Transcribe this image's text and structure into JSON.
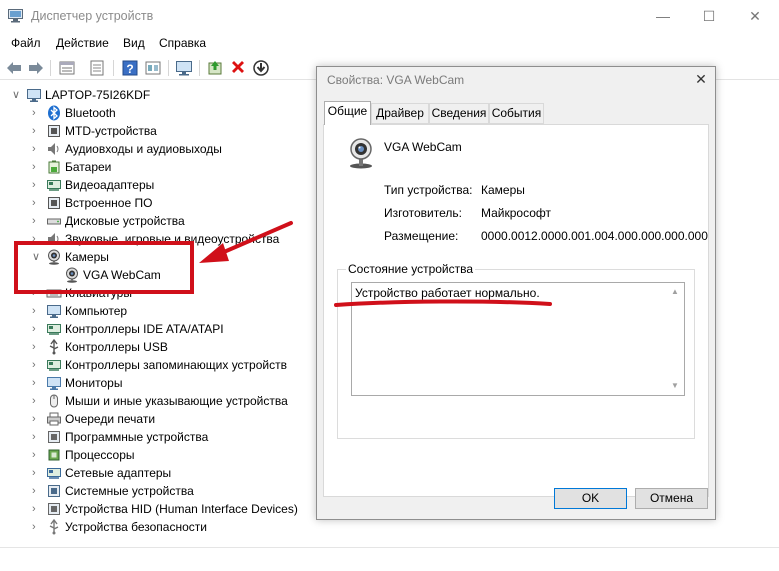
{
  "window": {
    "title": "Диспетчер устройств",
    "minimize": "—",
    "maximize": "☐",
    "close": "✕"
  },
  "menu": [
    "Файл",
    "Действие",
    "Вид",
    "Справка"
  ],
  "toolbar": [
    "back-icon",
    "forward-icon",
    "properties-view-icon",
    "list-icon",
    "help-icon",
    "view-icon",
    "monitor-icon",
    "update-driver-icon",
    "uninstall-icon",
    "download-icon"
  ],
  "tree": {
    "root": "LAPTOP-75I26KDF",
    "items": [
      {
        "label": "Bluetooth",
        "icon": "bluetooth-icon",
        "expanded": false
      },
      {
        "label": "MTD-устройства",
        "icon": "memory-device-icon",
        "expanded": false
      },
      {
        "label": "Аудиовходы и аудиовыходы",
        "icon": "speaker-icon",
        "expanded": false
      },
      {
        "label": "Батареи",
        "icon": "battery-icon",
        "expanded": false
      },
      {
        "label": "Видеоадаптеры",
        "icon": "display-adapter-icon",
        "expanded": false
      },
      {
        "label": "Встроенное ПО",
        "icon": "firmware-icon",
        "expanded": false
      },
      {
        "label": "Дисковые устройства",
        "icon": "disk-icon",
        "expanded": false
      },
      {
        "label": "Звуковые, игровые и видеоустройства",
        "icon": "sound-icon",
        "expanded": false
      },
      {
        "label": "Камеры",
        "icon": "camera-icon",
        "expanded": true
      },
      {
        "label": "VGA WebCam",
        "icon": "webcam-icon",
        "child": true
      },
      {
        "label": "Клавиатуры",
        "icon": "keyboard-icon",
        "expanded": false
      },
      {
        "label": "Компьютер",
        "icon": "computer-icon",
        "expanded": false
      },
      {
        "label": "Контроллеры IDE ATA/ATAPI",
        "icon": "ide-controller-icon",
        "expanded": false
      },
      {
        "label": "Контроллеры USB",
        "icon": "usb-icon",
        "expanded": false
      },
      {
        "label": "Контроллеры запоминающих устройств",
        "icon": "storage-controller-icon",
        "expanded": false
      },
      {
        "label": "Мониторы",
        "icon": "monitor-icon",
        "expanded": false
      },
      {
        "label": "Мыши и иные указывающие устройства",
        "icon": "mouse-icon",
        "expanded": false
      },
      {
        "label": "Очереди печати",
        "icon": "printer-icon",
        "expanded": false
      },
      {
        "label": "Программные устройства",
        "icon": "software-device-icon",
        "expanded": false
      },
      {
        "label": "Процессоры",
        "icon": "processor-icon",
        "expanded": false
      },
      {
        "label": "Сетевые адаптеры",
        "icon": "network-adapter-icon",
        "expanded": false
      },
      {
        "label": "Системные устройства",
        "icon": "system-device-icon",
        "expanded": false
      },
      {
        "label": "Устройства HID (Human Interface Devices)",
        "icon": "hid-icon",
        "expanded": false
      },
      {
        "label": "Устройства безопасности",
        "icon": "security-device-icon",
        "expanded": false
      }
    ]
  },
  "dialog": {
    "title": "Свойства: VGA WebCam",
    "close": "✕",
    "tabs": [
      "Общие",
      "Драйвер",
      "Сведения",
      "События"
    ],
    "active_tab": "Общие",
    "device_name": "VGA WebCam",
    "props": [
      {
        "key": "Тип устройства:",
        "value": "Камеры"
      },
      {
        "key": "Изготовитель:",
        "value": "Майкрософт"
      },
      {
        "key": "Размещение:",
        "value": "0000.0012.0000.001.004.000.000.000.000"
      }
    ],
    "status_legend": "Состояние устройства",
    "status_text": "Устройство работает нормально.",
    "ok": "OK",
    "cancel": "Отмена"
  },
  "colors": {
    "annotation_red": "#d0101a",
    "accent": "#0078d7"
  }
}
